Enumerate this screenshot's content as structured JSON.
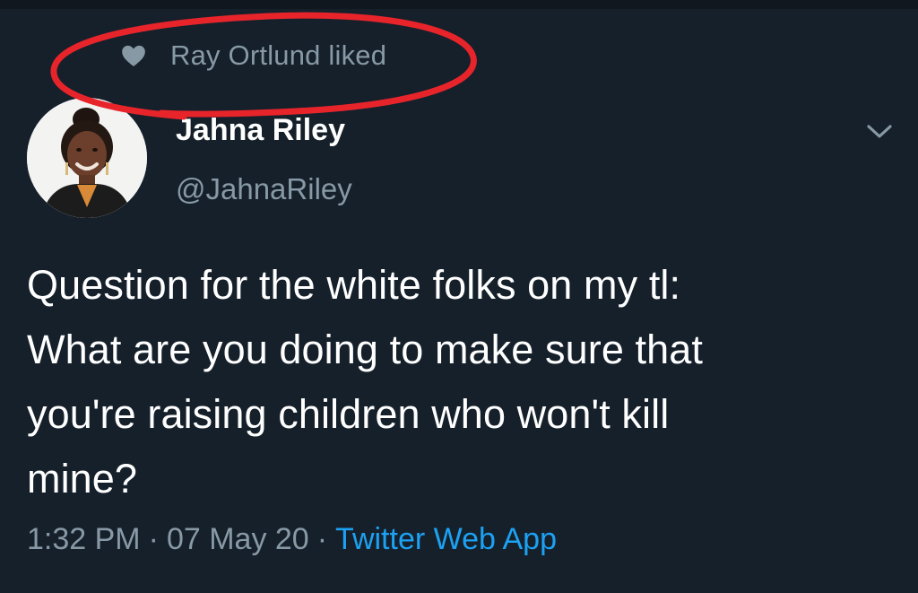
{
  "colors": {
    "background": "#15202b",
    "secondary_text": "#8899a6",
    "primary_text": "#ffffff",
    "link": "#1da1f2",
    "annotation": "#e8242b"
  },
  "social_context": {
    "icon": "heart-icon",
    "text": "Ray Ortlund liked"
  },
  "author": {
    "display_name": "Jahna Riley",
    "handle": "@JahnaRiley"
  },
  "menu": {
    "icon": "chevron-down-icon"
  },
  "tweet": {
    "lines": [
      "Question for the white folks on my tl:",
      "What are you doing to make sure that",
      "you're raising children who won't kill",
      "mine?"
    ]
  },
  "meta": {
    "time": "1:32 PM",
    "separator": "·",
    "date": "07 May 20",
    "source": "Twitter Web App"
  }
}
